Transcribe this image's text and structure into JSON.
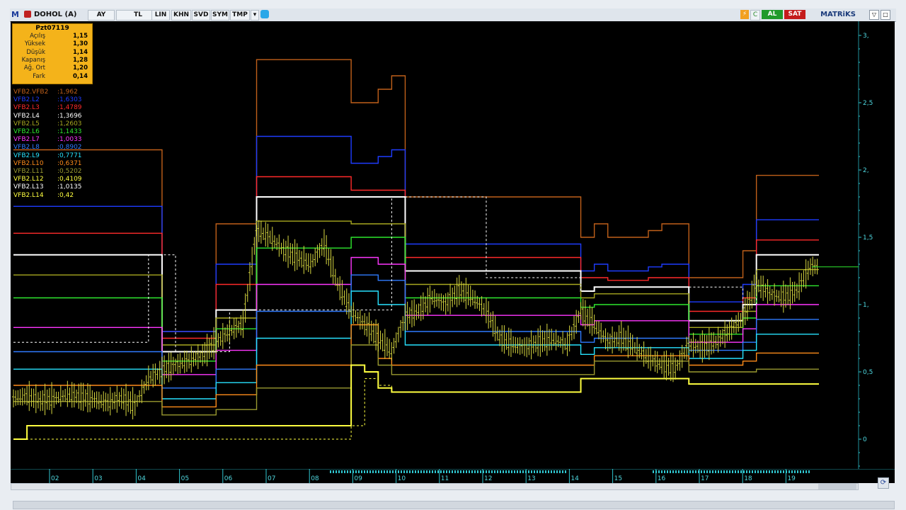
{
  "toolbar": {
    "symbol": "DOHOL (A)",
    "buttons": [
      "AY",
      "TL",
      "LIN",
      "KHN",
      "SVD",
      "SYM",
      "TMP"
    ],
    "al_label": "AL",
    "sat_label": "SAT",
    "brand": "MATRiKS"
  },
  "infobox": {
    "title": "Pzt07119",
    "rows": [
      {
        "label": "Açılış",
        "value": "1,15"
      },
      {
        "label": "Yüksek",
        "value": "1,30"
      },
      {
        "label": "Düşük",
        "value": "1,14"
      },
      {
        "label": "Kapanış",
        "value": "1,28"
      },
      {
        "label": "Ağ. Ort",
        "value": "1,20"
      },
      {
        "label": "Fark",
        "value": "0,14"
      }
    ]
  },
  "legend": [
    {
      "name": "VFB2.VFB2",
      "value": ":1,962",
      "color": "#c0601a"
    },
    {
      "name": "VFB2.L2",
      "value": ":1,6303",
      "color": "#1e3cff"
    },
    {
      "name": "VFB2.L3",
      "value": ":1,4789",
      "color": "#ff2a2a"
    },
    {
      "name": "VFB2.L4",
      "value": ":1,3696",
      "color": "#ffffff"
    },
    {
      "name": "VFB2.L5",
      "value": ":1,2603",
      "color": "#a8a820"
    },
    {
      "name": "VFB2.L6",
      "value": ":1,1433",
      "color": "#2ee82e"
    },
    {
      "name": "VFB2.L7",
      "value": ":1,0033",
      "color": "#ff36ff"
    },
    {
      "name": "VFB2.L8",
      "value": ":0,8902",
      "color": "#2f7bff"
    },
    {
      "name": "VFB2.L9",
      "value": ":0,7771",
      "color": "#27e3ff"
    },
    {
      "name": "VFB2.L10",
      "value": ":0,6371",
      "color": "#ff8c1a"
    },
    {
      "name": "VFB2.L11",
      "value": ":0,5202",
      "color": "#9a9a30"
    },
    {
      "name": "VFB2.L12",
      "value": ":0,4109",
      "color": "#ffff40"
    },
    {
      "name": "VFB2.L13",
      "value": ":1,0135",
      "color": "#ffffff"
    },
    {
      "name": "VFB2.L14",
      "value": ":0,42",
      "color": "#ffff40"
    }
  ],
  "chart_data": {
    "type": "line",
    "y_ticks": [
      "3,",
      "2,5",
      "2,",
      "1,5",
      "1,",
      "0,5",
      "0"
    ],
    "ylim": [
      0,
      3
    ],
    "x_ticks": [
      "02",
      "03",
      "04",
      "05",
      "06",
      "07",
      "08",
      "09",
      "10",
      "11",
      "12",
      "13",
      "14",
      "15",
      "16",
      "17",
      "18",
      "19"
    ],
    "last_value_line": 1.28,
    "series": [
      {
        "color": "#c0601a",
        "values": [
          2.15,
          2.15,
          2.15,
          2.15,
          2.15,
          2.15,
          2.15,
          2.15,
          2.15,
          2.15,
          2.15,
          0.8,
          0.8,
          0.8,
          0.8,
          1.6,
          1.6,
          1.6,
          2.82,
          2.82,
          2.82,
          2.82,
          2.82,
          2.82,
          2.82,
          2.5,
          2.5,
          2.6,
          2.7,
          1.8,
          1.8,
          1.8,
          1.8,
          1.8,
          1.8,
          1.8,
          1.8,
          1.8,
          1.8,
          1.8,
          1.8,
          1.8,
          1.5,
          1.6,
          1.5,
          1.5,
          1.5,
          1.55,
          1.6,
          1.6,
          1.2,
          1.2,
          1.2,
          1.2,
          1.4,
          1.96,
          1.96,
          1.96,
          1.96,
          1.96
        ]
      },
      {
        "color": "#1e3cff",
        "values": [
          1.73,
          1.73,
          1.73,
          1.73,
          1.73,
          1.73,
          1.73,
          1.73,
          1.73,
          1.73,
          1.73,
          0.8,
          0.8,
          0.8,
          0.8,
          1.3,
          1.3,
          1.3,
          2.25,
          2.25,
          2.25,
          2.25,
          2.25,
          2.25,
          2.25,
          2.05,
          2.05,
          2.1,
          2.15,
          1.45,
          1.45,
          1.45,
          1.45,
          1.45,
          1.45,
          1.45,
          1.45,
          1.45,
          1.45,
          1.45,
          1.45,
          1.45,
          1.25,
          1.3,
          1.25,
          1.25,
          1.25,
          1.28,
          1.3,
          1.3,
          1.02,
          1.02,
          1.02,
          1.02,
          1.15,
          1.63,
          1.63,
          1.63,
          1.63,
          1.63
        ]
      },
      {
        "color": "#ff2a2a",
        "values": [
          1.53,
          1.53,
          1.53,
          1.53,
          1.53,
          1.53,
          1.53,
          1.53,
          1.53,
          1.53,
          1.53,
          0.75,
          0.75,
          0.75,
          0.75,
          1.15,
          1.15,
          1.15,
          1.95,
          1.95,
          1.95,
          1.95,
          1.95,
          1.95,
          1.95,
          1.85,
          1.85,
          1.85,
          1.85,
          1.35,
          1.35,
          1.35,
          1.35,
          1.35,
          1.35,
          1.35,
          1.35,
          1.35,
          1.35,
          1.35,
          1.35,
          1.35,
          1.2,
          1.2,
          1.18,
          1.18,
          1.18,
          1.2,
          1.2,
          1.2,
          0.95,
          0.95,
          0.95,
          0.95,
          1.05,
          1.48,
          1.48,
          1.48,
          1.48,
          1.48
        ]
      },
      {
        "color": "#ffffff",
        "values": [
          1.37,
          1.37,
          1.37,
          1.37,
          1.37,
          1.37,
          1.37,
          1.37,
          1.37,
          1.37,
          1.37,
          0.65,
          0.65,
          0.65,
          0.65,
          0.96,
          0.96,
          0.96,
          1.8,
          1.8,
          1.8,
          1.8,
          1.8,
          1.8,
          1.8,
          1.8,
          1.8,
          1.8,
          1.8,
          1.25,
          1.25,
          1.25,
          1.25,
          1.25,
          1.25,
          1.25,
          1.25,
          1.25,
          1.25,
          1.25,
          1.25,
          1.25,
          1.1,
          1.13,
          1.13,
          1.13,
          1.13,
          1.13,
          1.13,
          1.13,
          0.88,
          0.88,
          0.88,
          0.88,
          1.0,
          1.37,
          1.37,
          1.37,
          1.37,
          1.37
        ]
      },
      {
        "color": "#a8a820",
        "values": [
          1.22,
          1.22,
          1.22,
          1.22,
          1.22,
          1.22,
          1.22,
          1.22,
          1.22,
          1.22,
          1.22,
          0.7,
          0.7,
          0.7,
          0.7,
          0.9,
          0.9,
          0.9,
          1.62,
          1.62,
          1.62,
          1.62,
          1.62,
          1.62,
          1.62,
          1.6,
          1.6,
          1.6,
          1.6,
          1.15,
          1.15,
          1.15,
          1.15,
          1.15,
          1.15,
          1.15,
          1.15,
          1.15,
          1.15,
          1.15,
          1.15,
          1.15,
          1.05,
          1.08,
          1.08,
          1.08,
          1.08,
          1.08,
          1.08,
          1.08,
          0.83,
          0.83,
          0.83,
          0.83,
          0.95,
          1.26,
          1.26,
          1.26,
          1.26,
          1.26
        ]
      },
      {
        "color": "#2ee82e",
        "values": [
          1.05,
          1.05,
          1.05,
          1.05,
          1.05,
          1.05,
          1.05,
          1.05,
          1.05,
          1.05,
          1.05,
          0.58,
          0.58,
          0.58,
          0.58,
          0.82,
          0.82,
          0.82,
          1.42,
          1.42,
          1.42,
          1.42,
          1.42,
          1.42,
          1.42,
          1.5,
          1.5,
          1.5,
          1.5,
          1.05,
          1.05,
          1.05,
          1.05,
          1.05,
          1.05,
          1.05,
          1.05,
          1.05,
          1.05,
          1.05,
          1.05,
          1.05,
          0.98,
          1.0,
          1.0,
          1.0,
          1.0,
          1.0,
          1.0,
          1.0,
          0.78,
          0.78,
          0.78,
          0.78,
          0.9,
          1.14,
          1.14,
          1.14,
          1.14,
          1.14
        ]
      },
      {
        "color": "#ff36ff",
        "values": [
          0.83,
          0.83,
          0.83,
          0.83,
          0.83,
          0.83,
          0.83,
          0.83,
          0.83,
          0.83,
          0.83,
          0.48,
          0.48,
          0.48,
          0.48,
          0.66,
          0.66,
          0.66,
          1.15,
          1.15,
          1.15,
          1.15,
          1.15,
          1.15,
          1.15,
          1.35,
          1.35,
          1.3,
          1.3,
          0.92,
          0.92,
          0.92,
          0.92,
          0.92,
          0.92,
          0.92,
          0.92,
          0.92,
          0.92,
          0.92,
          0.92,
          0.92,
          0.85,
          0.88,
          0.88,
          0.88,
          0.88,
          0.88,
          0.88,
          0.88,
          0.72,
          0.72,
          0.72,
          0.72,
          0.82,
          1.0,
          1.0,
          1.0,
          1.0,
          1.0
        ]
      },
      {
        "color": "#2f7bff",
        "values": [
          0.65,
          0.65,
          0.65,
          0.65,
          0.65,
          0.65,
          0.65,
          0.65,
          0.65,
          0.65,
          0.65,
          0.38,
          0.38,
          0.38,
          0.38,
          0.52,
          0.52,
          0.52,
          0.95,
          0.95,
          0.95,
          0.95,
          0.95,
          0.95,
          0.95,
          1.22,
          1.22,
          1.18,
          1.18,
          0.8,
          0.8,
          0.8,
          0.8,
          0.8,
          0.8,
          0.8,
          0.8,
          0.8,
          0.8,
          0.8,
          0.8,
          0.8,
          0.72,
          0.75,
          0.75,
          0.75,
          0.75,
          0.75,
          0.75,
          0.75,
          0.66,
          0.66,
          0.66,
          0.66,
          0.72,
          0.89,
          0.89,
          0.89,
          0.89,
          0.89
        ]
      },
      {
        "color": "#27e3ff",
        "values": [
          0.52,
          0.52,
          0.52,
          0.52,
          0.52,
          0.52,
          0.52,
          0.52,
          0.52,
          0.52,
          0.52,
          0.3,
          0.3,
          0.3,
          0.3,
          0.42,
          0.42,
          0.42,
          0.75,
          0.75,
          0.75,
          0.75,
          0.75,
          0.75,
          0.75,
          1.1,
          1.1,
          1.0,
          1.0,
          0.7,
          0.7,
          0.7,
          0.7,
          0.7,
          0.7,
          0.7,
          0.7,
          0.7,
          0.7,
          0.7,
          0.7,
          0.7,
          0.63,
          0.68,
          0.68,
          0.68,
          0.68,
          0.68,
          0.68,
          0.68,
          0.6,
          0.6,
          0.6,
          0.6,
          0.66,
          0.78,
          0.78,
          0.78,
          0.78,
          0.78
        ]
      },
      {
        "color": "#ff8c1a",
        "values": [
          0.4,
          0.4,
          0.4,
          0.4,
          0.4,
          0.4,
          0.4,
          0.4,
          0.4,
          0.4,
          0.4,
          0.24,
          0.24,
          0.24,
          0.24,
          0.33,
          0.33,
          0.33,
          0.55,
          0.55,
          0.55,
          0.55,
          0.55,
          0.55,
          0.55,
          0.85,
          0.85,
          0.6,
          0.55,
          0.55,
          0.55,
          0.55,
          0.55,
          0.55,
          0.55,
          0.55,
          0.55,
          0.55,
          0.55,
          0.55,
          0.55,
          0.55,
          0.55,
          0.62,
          0.62,
          0.62,
          0.62,
          0.62,
          0.62,
          0.62,
          0.55,
          0.55,
          0.55,
          0.55,
          0.58,
          0.64,
          0.64,
          0.64,
          0.64,
          0.64
        ]
      },
      {
        "color": "#9a9a30",
        "values": [
          0.28,
          0.28,
          0.28,
          0.28,
          0.28,
          0.28,
          0.28,
          0.28,
          0.28,
          0.28,
          0.28,
          0.18,
          0.18,
          0.18,
          0.18,
          0.22,
          0.22,
          0.22,
          0.38,
          0.38,
          0.38,
          0.38,
          0.38,
          0.38,
          0.38,
          0.7,
          0.7,
          0.55,
          0.48,
          0.48,
          0.48,
          0.48,
          0.48,
          0.48,
          0.48,
          0.48,
          0.48,
          0.48,
          0.48,
          0.48,
          0.48,
          0.48,
          0.48,
          0.58,
          0.58,
          0.58,
          0.58,
          0.58,
          0.58,
          0.58,
          0.5,
          0.5,
          0.5,
          0.5,
          0.5,
          0.52,
          0.52,
          0.52,
          0.52,
          0.52
        ]
      },
      {
        "color": "#ffff40",
        "values": [
          0.0,
          0.1,
          0.1,
          0.1,
          0.1,
          0.1,
          0.1,
          0.1,
          0.1,
          0.1,
          0.1,
          0.1,
          0.1,
          0.1,
          0.1,
          0.1,
          0.1,
          0.1,
          0.1,
          0.1,
          0.1,
          0.1,
          0.1,
          0.1,
          0.1,
          0.55,
          0.5,
          0.38,
          0.35,
          0.35,
          0.35,
          0.35,
          0.35,
          0.35,
          0.35,
          0.35,
          0.35,
          0.35,
          0.35,
          0.35,
          0.35,
          0.35,
          0.45,
          0.45,
          0.45,
          0.45,
          0.45,
          0.45,
          0.45,
          0.45,
          0.41,
          0.41,
          0.41,
          0.41,
          0.41,
          0.41,
          0.41,
          0.41,
          0.41,
          0.41
        ]
      }
    ],
    "price": [
      0.3,
      0.32,
      0.28,
      0.3,
      0.33,
      0.31,
      0.29,
      0.27,
      0.3,
      0.25,
      0.45,
      0.5,
      0.55,
      0.58,
      0.62,
      0.72,
      0.8,
      0.85,
      1.55,
      1.5,
      1.4,
      1.35,
      1.3,
      1.45,
      1.15,
      0.95,
      0.85,
      0.75,
      0.65,
      0.9,
      0.95,
      1.05,
      1.0,
      1.1,
      1.05,
      0.95,
      0.75,
      0.7,
      0.68,
      0.72,
      0.74,
      0.7,
      0.95,
      0.85,
      0.72,
      0.75,
      0.68,
      0.6,
      0.55,
      0.52,
      0.7,
      0.68,
      0.72,
      0.8,
      0.9,
      1.15,
      1.08,
      1.05,
      1.1,
      1.28
    ]
  }
}
